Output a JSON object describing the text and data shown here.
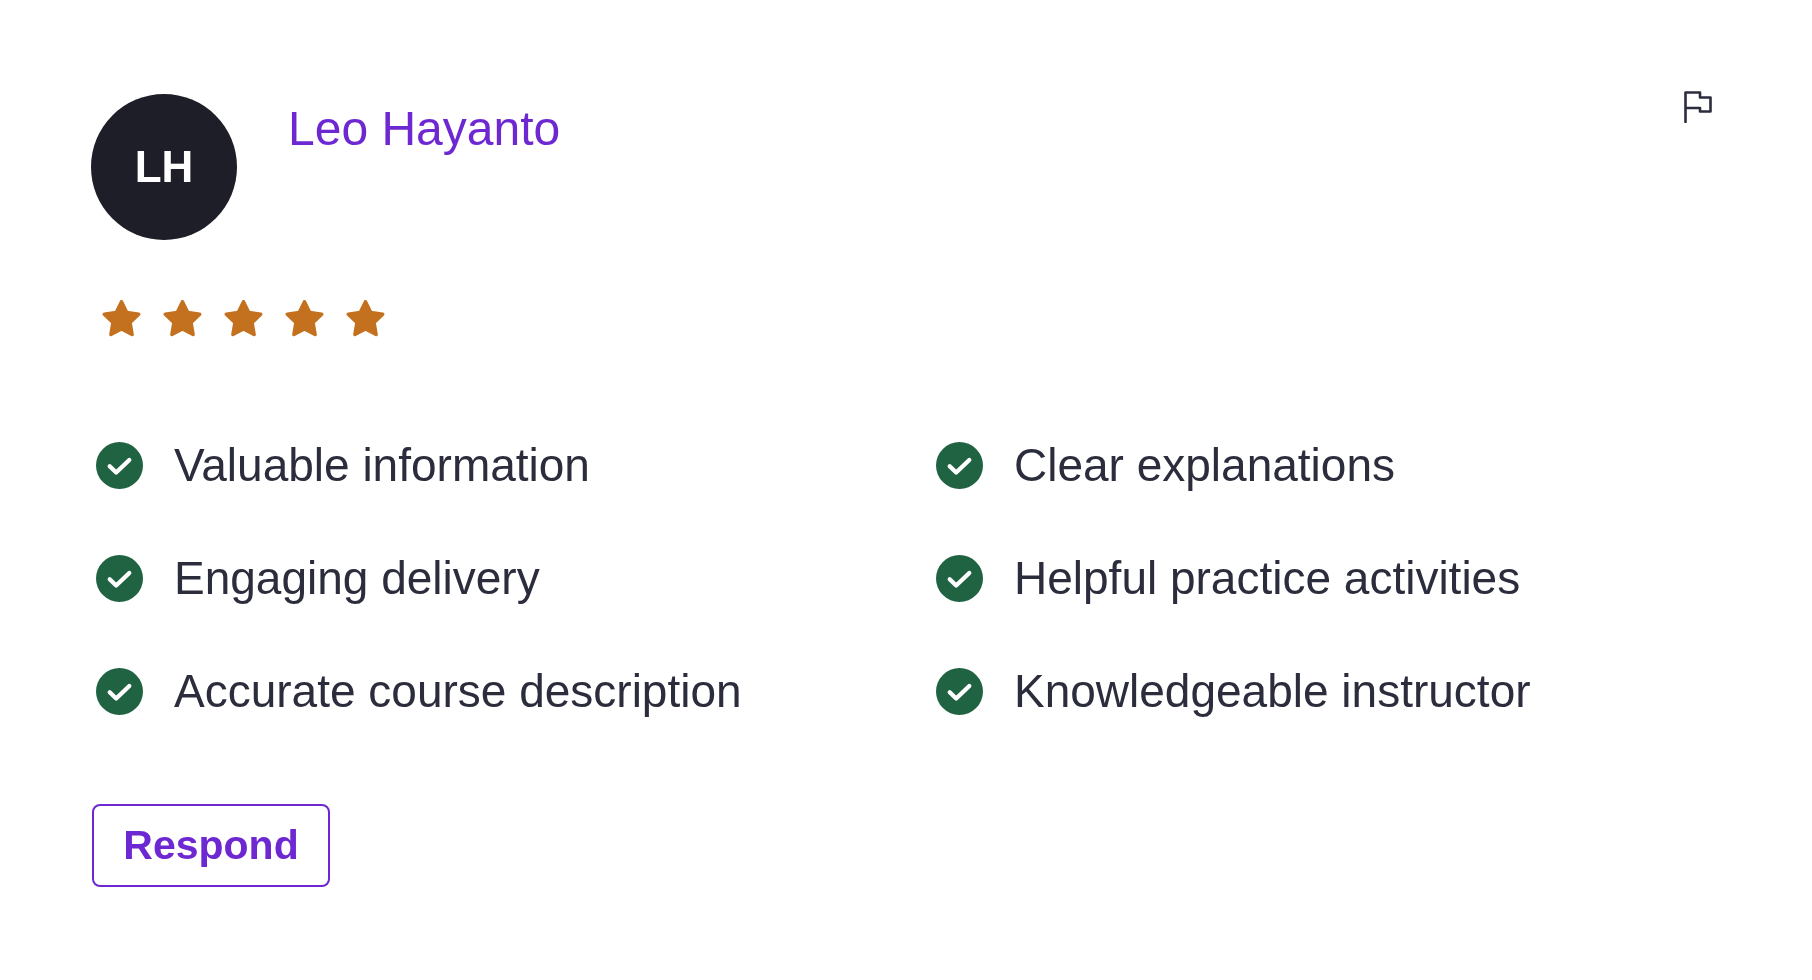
{
  "reviewer": {
    "initials": "LH",
    "name": "Leo Hayanto"
  },
  "rating": {
    "stars": 5
  },
  "feedback": [
    {
      "label": "Valuable information",
      "checked": true
    },
    {
      "label": "Clear explanations",
      "checked": true
    },
    {
      "label": "Engaging delivery",
      "checked": true
    },
    {
      "label": "Helpful practice activities",
      "checked": true
    },
    {
      "label": "Accurate course description",
      "checked": true
    },
    {
      "label": "Knowledgeable instructor",
      "checked": true
    }
  ],
  "respond_button": {
    "label": "Respond"
  }
}
